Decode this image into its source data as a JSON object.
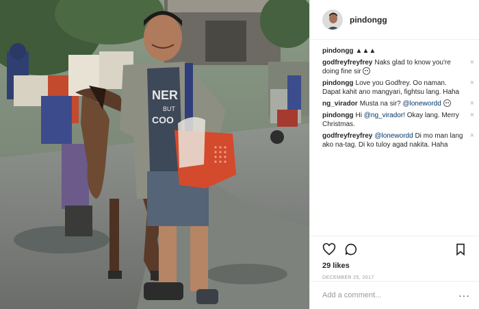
{
  "post": {
    "owner": "pindongg",
    "likes": "29 likes",
    "date": "DECEMBER 25, 2017"
  },
  "comments": [
    {
      "user": "pindongg",
      "text": "▲▲▲"
    },
    {
      "user": "godfreyfreyfrey",
      "text": "Naks glad to know you're doing fine sir",
      "emoji": "smiling-face"
    },
    {
      "user": "pindongg",
      "text": "Love you Godfrey. Oo naman. Dapat kahit ano mangyari, fightsu lang. Haha"
    },
    {
      "user": "ng_virador",
      "text": "Musta na sir?",
      "mention": "@lonewordd",
      "emoji": "grinning-face"
    },
    {
      "user": "pindongg",
      "text_before": "Hi",
      "mention": "@ng_virador!",
      "text": "Okay lang. Merry Christmas."
    },
    {
      "user": "godfreyfreyfrey",
      "mention": "@lonewordd",
      "text": "Di mo man lang ako na-tag. Di ko tuloy agad nakita. Haha"
    }
  ],
  "comment_input": {
    "placeholder": "Add a comment..."
  },
  "icons": {
    "like": "heart-icon",
    "comment": "comment-bubble-icon",
    "save": "bookmark-icon",
    "more": "more-options-icon",
    "remove": "close-icon"
  },
  "remove_glyph": "×",
  "more_glyph": "···",
  "colors": {
    "border": "#efefef",
    "mention": "#003569",
    "muted": "#999999",
    "text": "#262626"
  }
}
